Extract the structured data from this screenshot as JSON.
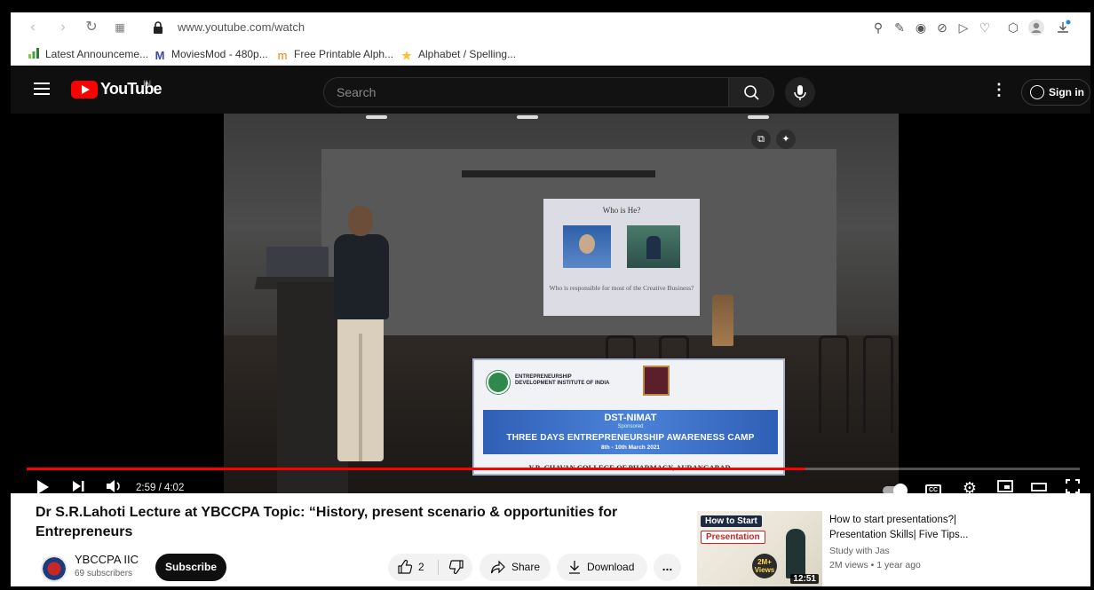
{
  "browser": {
    "url": "www.youtube.com/watch",
    "bookmarks": [
      {
        "label": "Latest Announceme...",
        "icon": "bar-chart-icon",
        "color": "#43a047"
      },
      {
        "label": "MoviesMod - 480p...",
        "icon": "m-logo-icon",
        "color": "#3949ab"
      },
      {
        "label": "Free Printable Alph...",
        "icon": "m-outline-icon",
        "color": "#f57c00"
      },
      {
        "label": "Alphabet / Spelling...",
        "icon": "star-icon",
        "color": "#fbc02d"
      }
    ]
  },
  "youtube": {
    "logo_text": "YouTube",
    "region": "IN",
    "search_placeholder": "Search",
    "signin_label": "Sign in",
    "brand_color": "#ff0000"
  },
  "player": {
    "current_time": "2:59",
    "duration": "4:02",
    "time_display": "2:59 / 4:02",
    "progress": 0.7397,
    "slide_title": "Who is He?",
    "slide_caption": "Who is responsible for most of the Creative Business?",
    "banner": {
      "org": "ENTREPRENEURSHIP DEVELOPMENT INSTITUTE OF INDIA",
      "line1": "DST-NIMAT",
      "line2": "Sponsored",
      "line3": "THREE DAYS ENTREPRENEURSHIP AWARENESS CAMP",
      "line4": "8th - 10th March 2021",
      "bottom": "Y.B. CHAVAN COLLEGE OF PHARMACY, AURANGABAD."
    }
  },
  "video": {
    "title": "Dr S.R.Lahoti Lecture at YBCCPA Topic: “History, present scenario & opportunities for Entrepreneurs",
    "channel_name": "YBCCPA IIC",
    "subscribers": "69 subscribers",
    "subscribe_label": "Subscribe",
    "like_count": "2",
    "share_label": "Share",
    "download_label": "Download",
    "more_label": "..."
  },
  "recommended": {
    "title": "How to start presentations?| Presentation Skills| Five Tips...",
    "channel": "Study with Jas",
    "meta": "2M views • 1 year ago",
    "duration": "12:51",
    "thumb_line1": "How to Start",
    "thumb_line2": "Presentation",
    "thumb_badge": "2M+ Views"
  }
}
